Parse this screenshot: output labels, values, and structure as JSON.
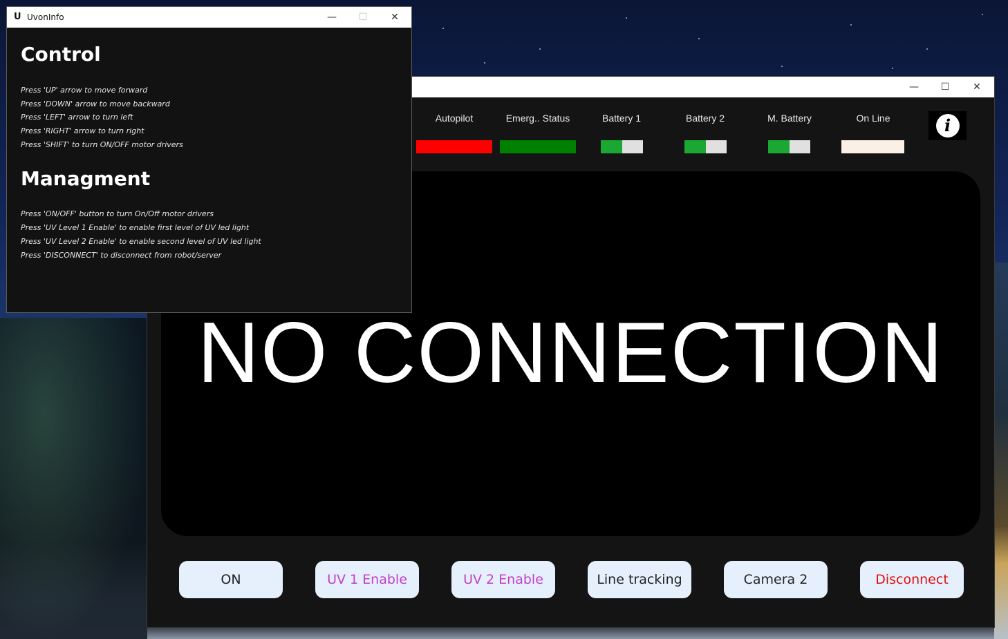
{
  "info_window": {
    "logo": "U",
    "title": "UvonInfo",
    "control_heading": "Control",
    "control_items": [
      "Press 'UP' arrow to move forward",
      "Press 'DOWN' arrow to move backward",
      "Press 'LEFT' arrow to turn left",
      "Press 'RIGHT' arrow to turn right",
      "Press 'SHIFT' to turn ON/OFF motor drivers"
    ],
    "management_heading": "Managment",
    "management_items": [
      "Press 'ON/OFF' button to turn On/Off motor drivers",
      "Press 'UV Level 1 Enable' to enable first level of UV led light",
      "Press 'UV Level 2 Enable' to enable second level of UV led light",
      "Press 'DISCONNECT' to disconnect from robot/server"
    ]
  },
  "main_window": {
    "status_headers": {
      "autopilot": "Autopilot",
      "emergency": "Emerg.. Status",
      "battery1": "Battery 1",
      "battery2": "Battery 2",
      "main_battery": "M. Battery",
      "online": "On Line"
    },
    "status_colors": {
      "autopilot": "#ff0000",
      "emergency": "#008000",
      "battery_fill": "#1aa832",
      "battery_empty": "#e0e0e0",
      "online": "#faf0e6"
    },
    "battery_levels": {
      "battery1": 0.5,
      "battery2": 0.5,
      "main_battery": 0.5
    },
    "info_icon": "i",
    "video_message": "NO CONNECTION",
    "buttons": {
      "on": "ON",
      "uv1": "UV 1 Enable",
      "uv2": "UV 2 Enable",
      "line_tracking": "Line tracking",
      "camera2": "Camera 2",
      "disconnect": "Disconnect"
    },
    "button_text_colors": {
      "on": "#222222",
      "uv1": "#c040c8",
      "uv2": "#c040c8",
      "line_tracking": "#222222",
      "camera2": "#222222",
      "disconnect": "#e01010"
    }
  }
}
